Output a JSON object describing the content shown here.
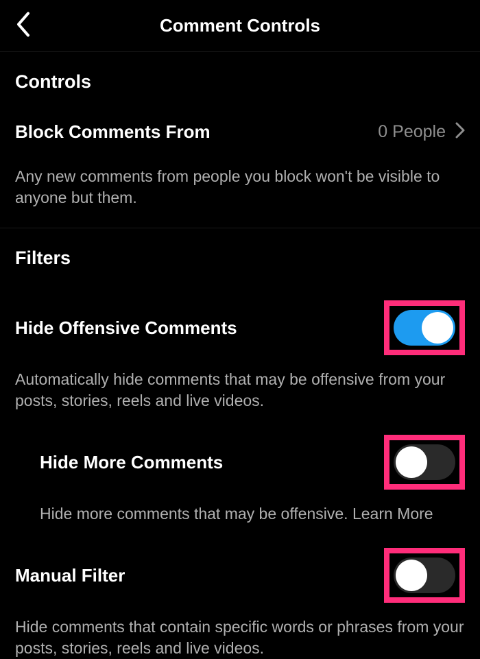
{
  "header": {
    "title": "Comment Controls"
  },
  "controls": {
    "heading": "Controls",
    "block": {
      "label": "Block Comments From",
      "value": "0 People",
      "description": "Any new comments from people you block won't be visible to anyone but them."
    }
  },
  "filters": {
    "heading": "Filters",
    "hideOffensive": {
      "label": "Hide Offensive Comments",
      "state": "on",
      "description": "Automatically hide comments that may be offensive from your posts, stories, reels and live videos."
    },
    "hideMore": {
      "label": "Hide More Comments",
      "state": "off",
      "description": "Hide more comments that may be offensive. ",
      "learnMore": "Learn More"
    },
    "manualFilter": {
      "label": "Manual Filter",
      "state": "off",
      "description": "Hide comments that contain specific words or phrases from your posts, stories, reels and live videos."
    }
  }
}
